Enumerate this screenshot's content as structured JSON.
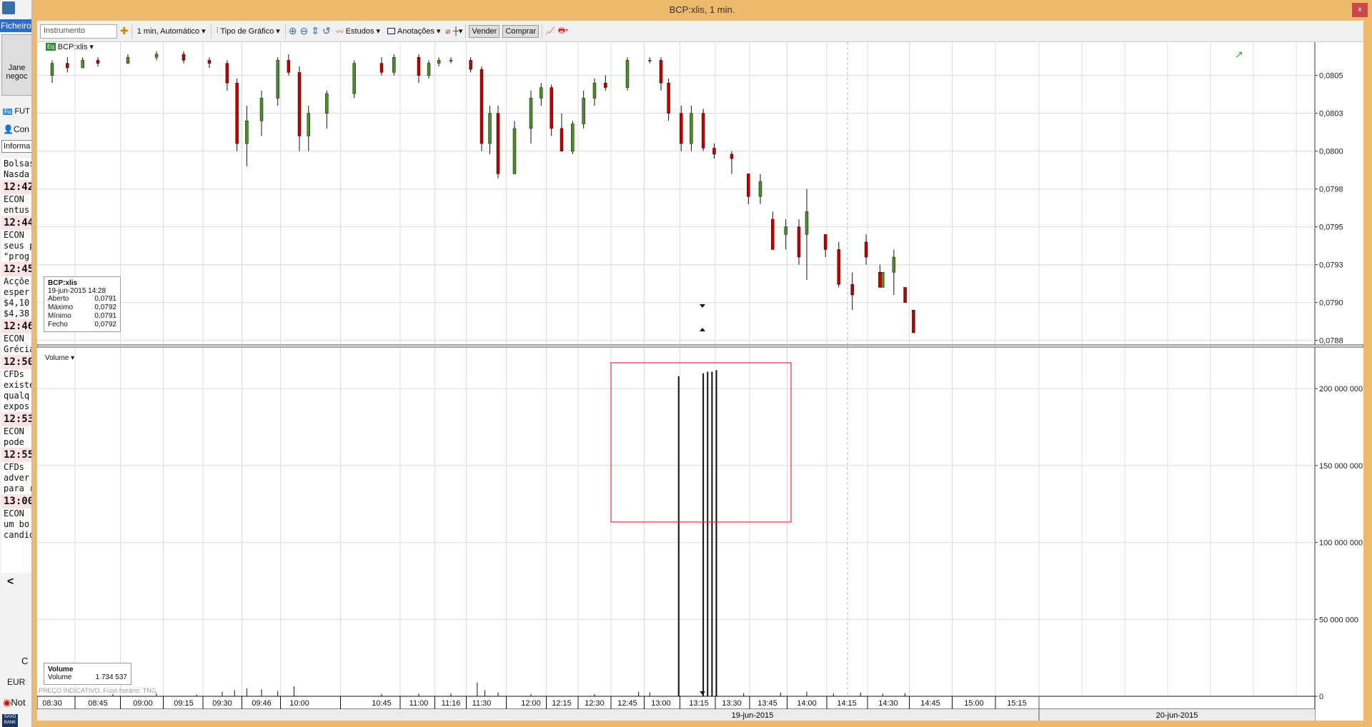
{
  "window": {
    "title": "BCP:xlis, 1 min.",
    "close_label": "x"
  },
  "sidebar": {
    "ficheiro": "Ficheiro",
    "janela_btn": [
      "Jane",
      "negoc"
    ],
    "fut": "FUT",
    "con": "Con",
    "info_field": "Informa",
    "news": [
      {
        "time": "",
        "lines": [
          "Bolsas",
          "Nasda"
        ]
      },
      {
        "time": "12:42",
        "lines": [
          "ECON",
          "entus"
        ]
      },
      {
        "time": "12:44",
        "lines": [
          "ECON",
          "seus p",
          "\"prog"
        ]
      },
      {
        "time": "12:45",
        "lines": [
          "Acçõe",
          "esper",
          "$4,10",
          "$4,38"
        ]
      },
      {
        "time": "12:46",
        "lines": [
          "ECON",
          "Grécia"
        ]
      },
      {
        "time": "12:50",
        "lines": [
          "CFDs",
          "existe",
          "qualq",
          "expos"
        ]
      },
      {
        "time": "12:53",
        "lines": [
          "ECON",
          "pode"
        ]
      },
      {
        "time": "12:55",
        "lines": [
          "CFDs",
          "adver",
          "para r"
        ]
      },
      {
        "time": "13:00",
        "lines": [
          "ECON",
          "um bo",
          "candid"
        ]
      }
    ],
    "scroll_left": "<",
    "c_label": "C",
    "currency": "EUR",
    "notif": "Not",
    "saxo": "SAXO BANK"
  },
  "toolbar": {
    "instrument_placeholder": "Instrumento",
    "interval": "1 min,  Automático",
    "chart_type": "Tipo de Gráfico",
    "studies": "Estudos",
    "annotations": "Anotações",
    "sell": "Vender",
    "buy": "Comprar"
  },
  "legend": {
    "instrument": "BCP:xlis"
  },
  "info": {
    "title": "BCP:xlis",
    "datetime": "19-jun-2015 14:28",
    "rows": [
      [
        "Aberto",
        "0,0791"
      ],
      [
        "Máximo",
        "0,0792"
      ],
      [
        "Mínimo",
        "0,0791"
      ],
      [
        "Fecho",
        "0,0792"
      ]
    ]
  },
  "volume_pane": {
    "label": "Volume",
    "box_title": "Volume",
    "box_label": "Volume",
    "box_value": "1 734 537",
    "footer": "PREÇO INDICATIVO.  Fuso horário: TNG"
  },
  "colors": {
    "up": "#4e8a2e",
    "down": "#c00000",
    "frame": "#edb96b",
    "annotation": "#e03030"
  },
  "chart_data": [
    {
      "type": "candlestick",
      "title": "BCP:xlis",
      "y_ticks": [
        "0,0805",
        "0,0803",
        "0,0800",
        "0,0798",
        "0,0795",
        "0,0793",
        "0,0790",
        "0,0788"
      ],
      "y_tick_values": [
        0.0805,
        0.08025,
        0.08,
        0.07975,
        0.0795,
        0.07925,
        0.079,
        0.07875
      ],
      "ylim": [
        0.07872,
        0.08072
      ],
      "grid": true,
      "bars": [
        [
          "08:30",
          0.0805,
          0.0806,
          0.08045,
          0.08058
        ],
        [
          "08:35",
          0.08058,
          0.08062,
          0.08052,
          0.08055
        ],
        [
          "08:40",
          0.08055,
          0.08062,
          0.08055,
          0.0806
        ],
        [
          "08:45",
          0.0806,
          0.08062,
          0.08056,
          0.08058
        ],
        [
          "08:55",
          0.08058,
          0.08064,
          0.08058,
          0.08062
        ],
        [
          "09:05",
          0.08062,
          0.08066,
          0.0806,
          0.08064
        ],
        [
          "09:15",
          0.08064,
          0.08066,
          0.08058,
          0.0806
        ],
        [
          "09:25",
          0.0806,
          0.08062,
          0.08055,
          0.08058
        ],
        [
          "09:32",
          0.08058,
          0.0806,
          0.0804,
          0.08045
        ],
        [
          "09:36",
          0.08045,
          0.08048,
          0.08,
          0.08005
        ],
        [
          "09:40",
          0.08005,
          0.0803,
          0.0799,
          0.0802
        ],
        [
          "09:46",
          0.0802,
          0.0804,
          0.0801,
          0.08035
        ],
        [
          "09:52",
          0.08035,
          0.08062,
          0.0803,
          0.0806
        ],
        [
          "09:56",
          0.0806,
          0.08064,
          0.0805,
          0.08052
        ],
        [
          "10:00",
          0.08052,
          0.08056,
          0.08,
          0.0801
        ],
        [
          "10:05",
          0.0801,
          0.0803,
          0.08,
          0.08025
        ],
        [
          "10:15",
          0.08025,
          0.0804,
          0.08015,
          0.08038
        ],
        [
          "10:30",
          0.08038,
          0.0806,
          0.08035,
          0.08058
        ],
        [
          "10:45",
          0.08058,
          0.08062,
          0.0805,
          0.08052
        ],
        [
          "10:50",
          0.08052,
          0.08064,
          0.0805,
          0.08062
        ],
        [
          "11:00",
          0.08062,
          0.08064,
          0.08045,
          0.0805
        ],
        [
          "11:05",
          0.0805,
          0.0806,
          0.08048,
          0.08058
        ],
        [
          "11:10",
          0.08058,
          0.08062,
          0.08056,
          0.0806
        ],
        [
          "11:16",
          0.0806,
          0.08062,
          0.08058,
          0.0806
        ],
        [
          "11:25",
          0.0806,
          0.08062,
          0.08052,
          0.08054
        ],
        [
          "11:30",
          0.08054,
          0.08056,
          0.08,
          0.08005
        ],
        [
          "11:35",
          0.08005,
          0.0803,
          0.07998,
          0.08025
        ],
        [
          "11:40",
          0.08025,
          0.0803,
          0.07982,
          0.07985
        ],
        [
          "11:50",
          0.07985,
          0.0802,
          0.07985,
          0.08015
        ],
        [
          "12:00",
          0.08015,
          0.0804,
          0.08005,
          0.08035
        ],
        [
          "12:05",
          0.08035,
          0.08045,
          0.0803,
          0.08042
        ],
        [
          "12:10",
          0.08042,
          0.08044,
          0.0801,
          0.08015
        ],
        [
          "12:15",
          0.08015,
          0.08025,
          0.08,
          0.08
        ],
        [
          "12:20",
          0.08,
          0.0802,
          0.07998,
          0.08018
        ],
        [
          "12:25",
          0.08018,
          0.0804,
          0.08015,
          0.08035
        ],
        [
          "12:30",
          0.08035,
          0.08048,
          0.0803,
          0.08045
        ],
        [
          "12:35",
          0.08045,
          0.0805,
          0.0804,
          0.08042
        ],
        [
          "12:45",
          0.08042,
          0.08062,
          0.0804,
          0.0806
        ],
        [
          "12:55",
          0.0806,
          0.08062,
          0.08058,
          0.0806
        ],
        [
          "13:00",
          0.0806,
          0.08062,
          0.0804,
          0.08045
        ],
        [
          "13:03",
          0.08045,
          0.08048,
          0.0802,
          0.08025
        ],
        [
          "13:08",
          0.08025,
          0.0803,
          0.08,
          0.08005
        ],
        [
          "13:12",
          0.08005,
          0.0803,
          0.08,
          0.08025
        ],
        [
          "13:17",
          0.08025,
          0.08028,
          0.08,
          0.08002
        ],
        [
          "13:22",
          0.08002,
          0.08005,
          0.07995,
          0.07998
        ],
        [
          "13:30",
          0.07998,
          0.08,
          0.07985,
          0.07995
        ],
        [
          "13:37",
          0.07985,
          0.07985,
          0.07965,
          0.0797
        ],
        [
          "13:42",
          0.0797,
          0.07985,
          0.07965,
          0.0798
        ],
        [
          "13:47",
          0.07955,
          0.0796,
          0.07935,
          0.07935
        ],
        [
          "13:52",
          0.07945,
          0.07955,
          0.07935,
          0.0795
        ],
        [
          "13:57",
          0.0795,
          0.07955,
          0.07925,
          0.0793
        ],
        [
          "14:00",
          0.07945,
          0.07975,
          0.07915,
          0.0796
        ],
        [
          "14:07",
          0.07945,
          0.07945,
          0.0793,
          0.07935
        ],
        [
          "14:12",
          0.07935,
          0.0794,
          0.0791,
          0.07912
        ],
        [
          "14:17",
          0.07912,
          0.0792,
          0.07895,
          0.07905
        ],
        [
          "14:22",
          0.0794,
          0.07945,
          0.07925,
          0.0793
        ],
        [
          "14:27",
          0.0792,
          0.07925,
          0.0791,
          0.0791
        ],
        [
          "14:28",
          0.0791,
          0.0792,
          0.0791,
          0.0792
        ],
        [
          "14:32",
          0.0792,
          0.07935,
          0.07905,
          0.0793
        ],
        [
          "14:36",
          0.0791,
          0.0791,
          0.079,
          0.079
        ],
        [
          "14:39",
          0.07895,
          0.07895,
          0.0788,
          0.0788
        ]
      ]
    },
    {
      "type": "bar",
      "title": "Volume",
      "y_ticks": [
        "200 000 000",
        "150 000 000",
        "100 000 000",
        "50 000 000",
        "0"
      ],
      "y_tick_values": [
        200000000,
        150000000,
        100000000,
        50000000,
        0
      ],
      "ylim": [
        0,
        227000000
      ],
      "grid": true,
      "x_ticks": [
        "08:30",
        "08:45",
        "09:00",
        "09:15",
        "09:30",
        "09:46",
        "10:00",
        "10:45",
        "11:00",
        "11:16",
        "11:30",
        "12:00",
        "12:15",
        "12:30",
        "12:45",
        "13:00",
        "13:15",
        "13:30",
        "13:45",
        "14:00",
        "14:15",
        "14:30",
        "14:45",
        "15:00",
        "15:15"
      ],
      "dates": [
        "19-jun-2015",
        "20-jun-2015"
      ],
      "bars": [
        [
          "08:50",
          1500000
        ],
        [
          "09:05",
          2000000
        ],
        [
          "09:20",
          1200000
        ],
        [
          "09:30",
          3000000
        ],
        [
          "09:35",
          4000000
        ],
        [
          "09:40",
          5000000
        ],
        [
          "09:46",
          4500000
        ],
        [
          "09:52",
          3500000
        ],
        [
          "09:58",
          6500000
        ],
        [
          "10:45",
          1500000
        ],
        [
          "11:00",
          1800000
        ],
        [
          "11:16",
          2000000
        ],
        [
          "11:28",
          9000000
        ],
        [
          "11:32",
          4000000
        ],
        [
          "11:40",
          2500000
        ],
        [
          "12:00",
          1500000
        ],
        [
          "12:30",
          1500000
        ],
        [
          "12:50",
          3000000
        ],
        [
          "12:55",
          2500000
        ],
        [
          "13:07",
          208000000
        ],
        [
          "13:17",
          210000000
        ],
        [
          "13:19",
          211000000
        ],
        [
          "13:21",
          211000000
        ],
        [
          "13:23",
          212000000
        ],
        [
          "13:35",
          2000000
        ],
        [
          "13:50",
          2500000
        ],
        [
          "14:00",
          3000000
        ],
        [
          "14:10",
          2000000
        ],
        [
          "14:20",
          2500000
        ],
        [
          "14:28",
          1734537
        ],
        [
          "14:36",
          2000000
        ]
      ]
    }
  ]
}
